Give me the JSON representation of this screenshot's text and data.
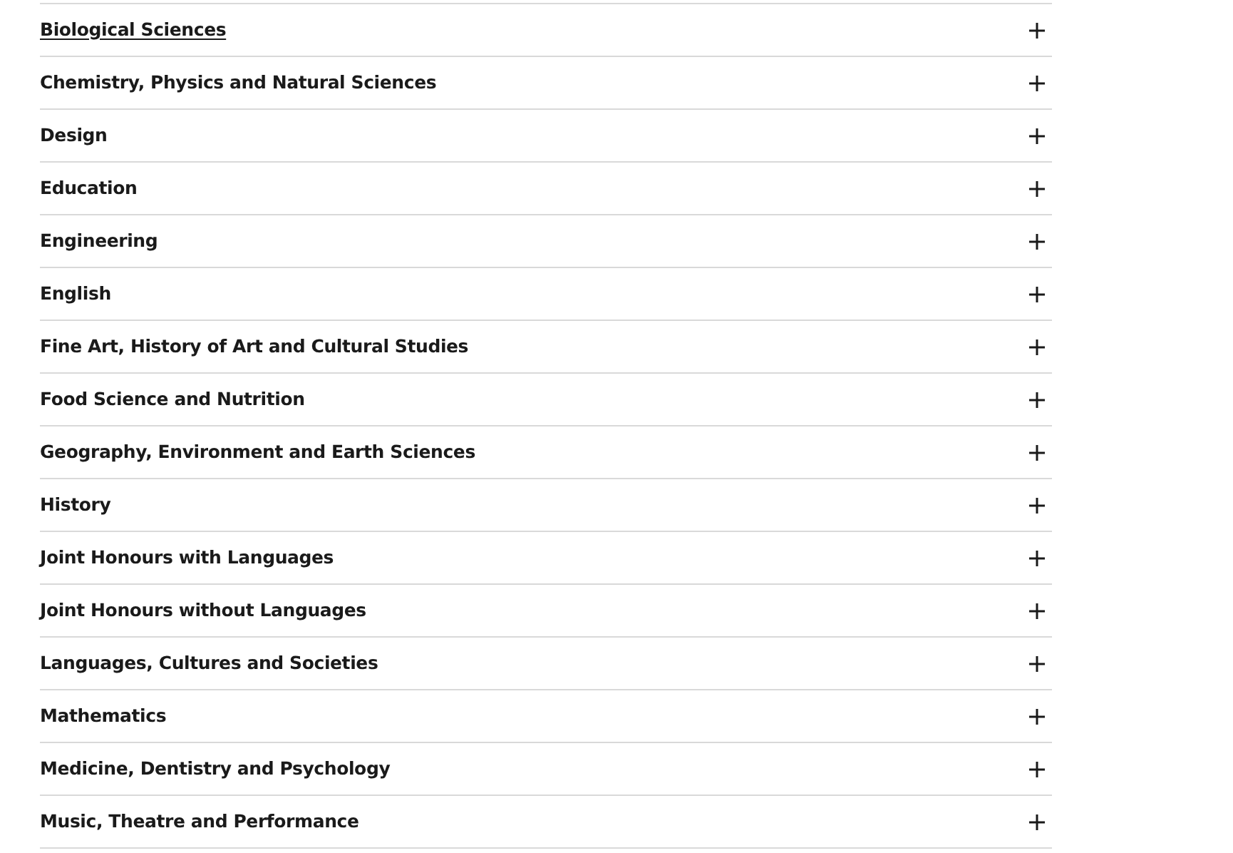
{
  "accordion": [
    {
      "label": "Biological Sciences",
      "hovered": true,
      "expanded": false
    },
    {
      "label": "Chemistry, Physics and Natural Sciences",
      "hovered": false,
      "expanded": false
    },
    {
      "label": "Design",
      "hovered": false,
      "expanded": false
    },
    {
      "label": "Education",
      "hovered": false,
      "expanded": false
    },
    {
      "label": "Engineering",
      "hovered": false,
      "expanded": false
    },
    {
      "label": "English",
      "hovered": false,
      "expanded": false
    },
    {
      "label": "Fine Art, History of Art and Cultural Studies",
      "hovered": false,
      "expanded": false
    },
    {
      "label": "Food Science and Nutrition",
      "hovered": false,
      "expanded": false
    },
    {
      "label": "Geography, Environment and Earth Sciences",
      "hovered": false,
      "expanded": false
    },
    {
      "label": "History",
      "hovered": false,
      "expanded": false
    },
    {
      "label": "Joint Honours with Languages",
      "hovered": false,
      "expanded": false
    },
    {
      "label": "Joint Honours without Languages",
      "hovered": false,
      "expanded": false
    },
    {
      "label": "Languages, Cultures and Societies",
      "hovered": false,
      "expanded": false
    },
    {
      "label": "Mathematics",
      "hovered": false,
      "expanded": false
    },
    {
      "label": "Medicine, Dentistry and Psychology",
      "hovered": false,
      "expanded": false
    },
    {
      "label": "Music, Theatre and Performance",
      "hovered": false,
      "expanded": false
    }
  ]
}
